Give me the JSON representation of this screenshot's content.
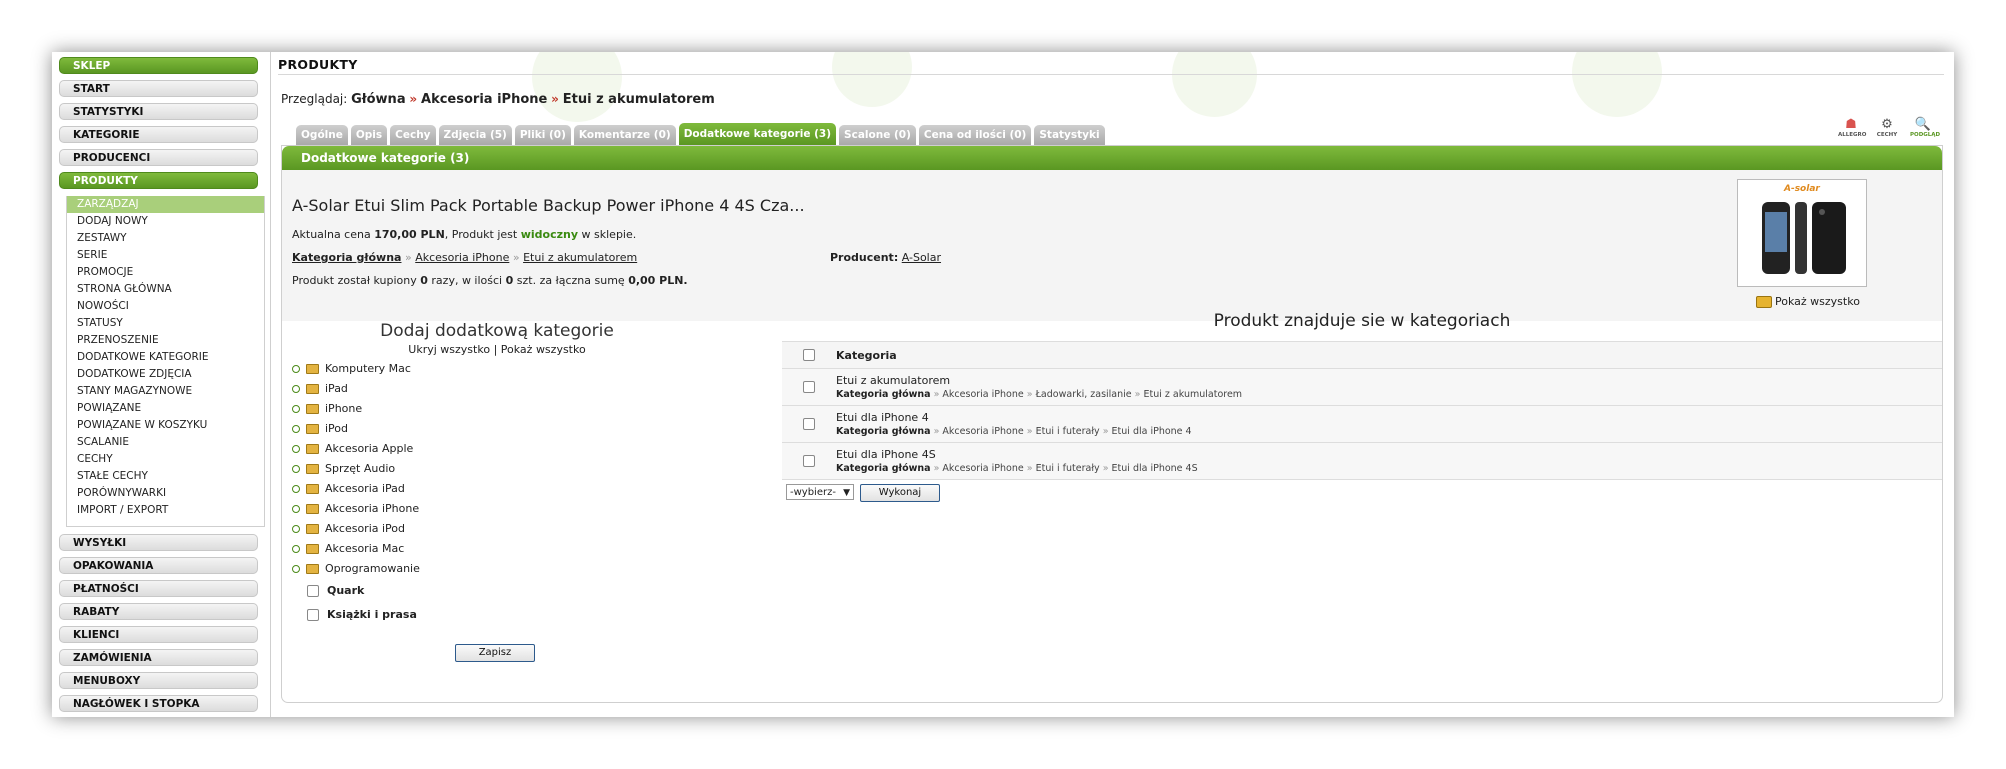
{
  "sidebar": {
    "top_sections": [
      "SKLEP",
      "START",
      "STATYSTYKI",
      "KATEGORIE",
      "PRODUCENCI",
      "PRODUKTY"
    ],
    "submenu": [
      "ZARZĄDZAJ",
      "DODAJ NOWY",
      "ZESTAWY",
      "SERIE",
      "PROMOCJE",
      "STRONA GŁÓWNA",
      "NOWOŚCI",
      "STATUSY",
      "PRZENOSZENIE",
      "DODATKOWE KATEGORIE",
      "DODATKOWE ZDJĘCIA",
      "STANY MAGAZYNOWE",
      "POWIĄZANE",
      "POWIĄZANE W KOSZYKU",
      "SCALANIE",
      "CECHY",
      "STAŁE CECHY",
      "PORÓWNYWARKI",
      "IMPORT / EXPORT"
    ],
    "bottom_sections": [
      "WYSYŁKI",
      "OPAKOWANIA",
      "PŁATNOŚCI",
      "RABATY",
      "KLIENCI",
      "ZAMÓWIENIA",
      "MENUBOXY",
      "NAGŁÓWEK I STOPKA"
    ]
  },
  "header": {
    "title": "PRODUKTY",
    "breadcrumb_label": "Przeglądaj:",
    "breadcrumb": [
      "Główna",
      "Akcesoria iPhone",
      "Etui z akumulatorem"
    ],
    "breadcrumb_sep": "»"
  },
  "tabs": [
    "Ogólne",
    "Opis",
    "Cechy",
    "Zdjęcia (5)",
    "Pliki (0)",
    "Komentarze (0)",
    "Dodatkowe kategorie (3)",
    "Scalone (0)",
    "Cena od ilości (0)",
    "Statystyki"
  ],
  "tools": [
    {
      "label": "ALLEGRO",
      "icon": "allegro-icon",
      "glyph": "☗"
    },
    {
      "label": "CECHY",
      "icon": "gear-icon",
      "glyph": "⚙"
    },
    {
      "label": "PODGLĄD",
      "icon": "magnifier-icon",
      "glyph": "🔍"
    }
  ],
  "panel": {
    "heading": "Dodatkowe kategorie (3)",
    "product_name": "A-Solar Etui Slim Pack Portable Backup Power iPhone 4 4S Cza...",
    "price_prefix": "Aktualna cena ",
    "price": "170,00 PLN",
    "visibility_prefix": ", Produkt jest ",
    "visibility": "widoczny",
    "visibility_suffix": " w sklepie.",
    "main_category_label": "Kategoria główna",
    "main_category_path": [
      "Akcesoria iPhone",
      "Etui z akumulatorem"
    ],
    "producer_label": "Producent:",
    "producer": "A-Solar",
    "purchase_prefix": "Produkt został kupiony ",
    "purchase_times": "0",
    "purchase_mid": " razy, w ilości ",
    "purchase_qty": "0",
    "purchase_mid2": " szt. za łączna sumę ",
    "purchase_sum": "0,00 PLN.",
    "thumb_brand": "A-solar",
    "show_all": "Pokaż wszystko"
  },
  "add_category": {
    "title": "Dodaj dodatkową kategorie",
    "hide_all": "Ukryj wszystko",
    "toggle_sep": "|",
    "show_all": "Pokaż wszystko",
    "tree": [
      "Komputery Mac",
      "iPad",
      "iPhone",
      "iPod",
      "Akcesoria Apple",
      "Sprzęt Audio",
      "Akcesoria iPad",
      "Akcesoria iPhone",
      "Akcesoria iPod",
      "Akcesoria Mac",
      "Oprogramowanie"
    ],
    "checkboxes": [
      "Quark",
      "Książki i prasa"
    ],
    "save_label": "Zapisz"
  },
  "product_categories": {
    "title": "Produkt znajduje sie w kategoriach",
    "column": "Kategoria",
    "rows": [
      {
        "name": "Etui z akumulatorem",
        "root": "Kategoria główna",
        "path": [
          "Akcesoria iPhone",
          "Ładowarki, zasilanie",
          "Etui z akumulatorem"
        ]
      },
      {
        "name": "Etui dla iPhone 4",
        "root": "Kategoria główna",
        "path": [
          "Akcesoria iPhone",
          "Etui i futerały",
          "Etui dla iPhone 4"
        ]
      },
      {
        "name": "Etui dla iPhone 4S",
        "root": "Kategoria główna",
        "path": [
          "Akcesoria iPhone",
          "Etui i futerały",
          "Etui dla iPhone 4S"
        ]
      }
    ],
    "path_sep": "»",
    "select_value": "-wybierz-",
    "execute_label": "Wykonaj"
  }
}
